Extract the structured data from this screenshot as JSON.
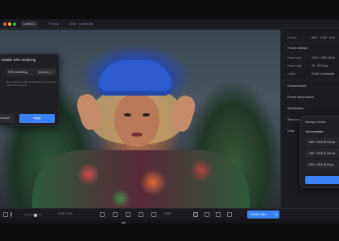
{
  "window": {
    "tabs": [
      {
        "label": "Untitled-1"
      },
      {
        "label": "Preview"
      },
      {
        "label": "Edits · portrait.heic"
      }
    ]
  },
  "dialog": {
    "title": "Enable GPU rendering",
    "field_label": "GPU rendering",
    "select_value": "Process L...",
    "description": "Use hardware GPU acceleration for rendering effects and exports.",
    "cancel_label": "Cancel",
    "confirm_label": "Apply"
  },
  "inspector": {
    "rows": [
      {
        "label": "Format",
        "value": "MP4 · H.264 · 8-bit"
      },
      {
        "label": "Frame settings",
        "value": ""
      },
      {
        "label": "Frame size",
        "value": "1920 × 1080 (16:9)"
      },
      {
        "label": "Frame rate",
        "value": "30 · 29.97 fps"
      },
      {
        "label": "Codec",
        "value": "H.264 Constrained"
      },
      {
        "label": "Enhancement",
        "value": ""
      },
      {
        "label": "Frame interpolation",
        "value": ""
      },
      {
        "label": "Stabilization",
        "value": ""
      },
      {
        "label": "Slow mo",
        "value": ""
      },
      {
        "label": "Grain",
        "value": ""
      }
    ]
  },
  "presets": {
    "title": "Manage presets",
    "subtitle": "Your presets",
    "items": [
      {
        "label": "1080 × 1920 @ 120 fps"
      },
      {
        "label": "1080 × 1920 @ 240 fps"
      },
      {
        "label": "1080 × 3320 @ 60 fps"
      }
    ]
  },
  "toolbar": {
    "timecode": "00:00:12:08",
    "zoom": "100%",
    "export_label": "Render video"
  },
  "colors": {
    "accent": "#3b82f6",
    "background": "#17181b",
    "panel": "#1b1c20"
  },
  "icons": [
    "play-icon",
    "scissors-icon",
    "crop-icon",
    "undo-icon",
    "redo-icon",
    "grid-icon",
    "fullscreen-icon",
    "chevron-down-icon"
  ]
}
